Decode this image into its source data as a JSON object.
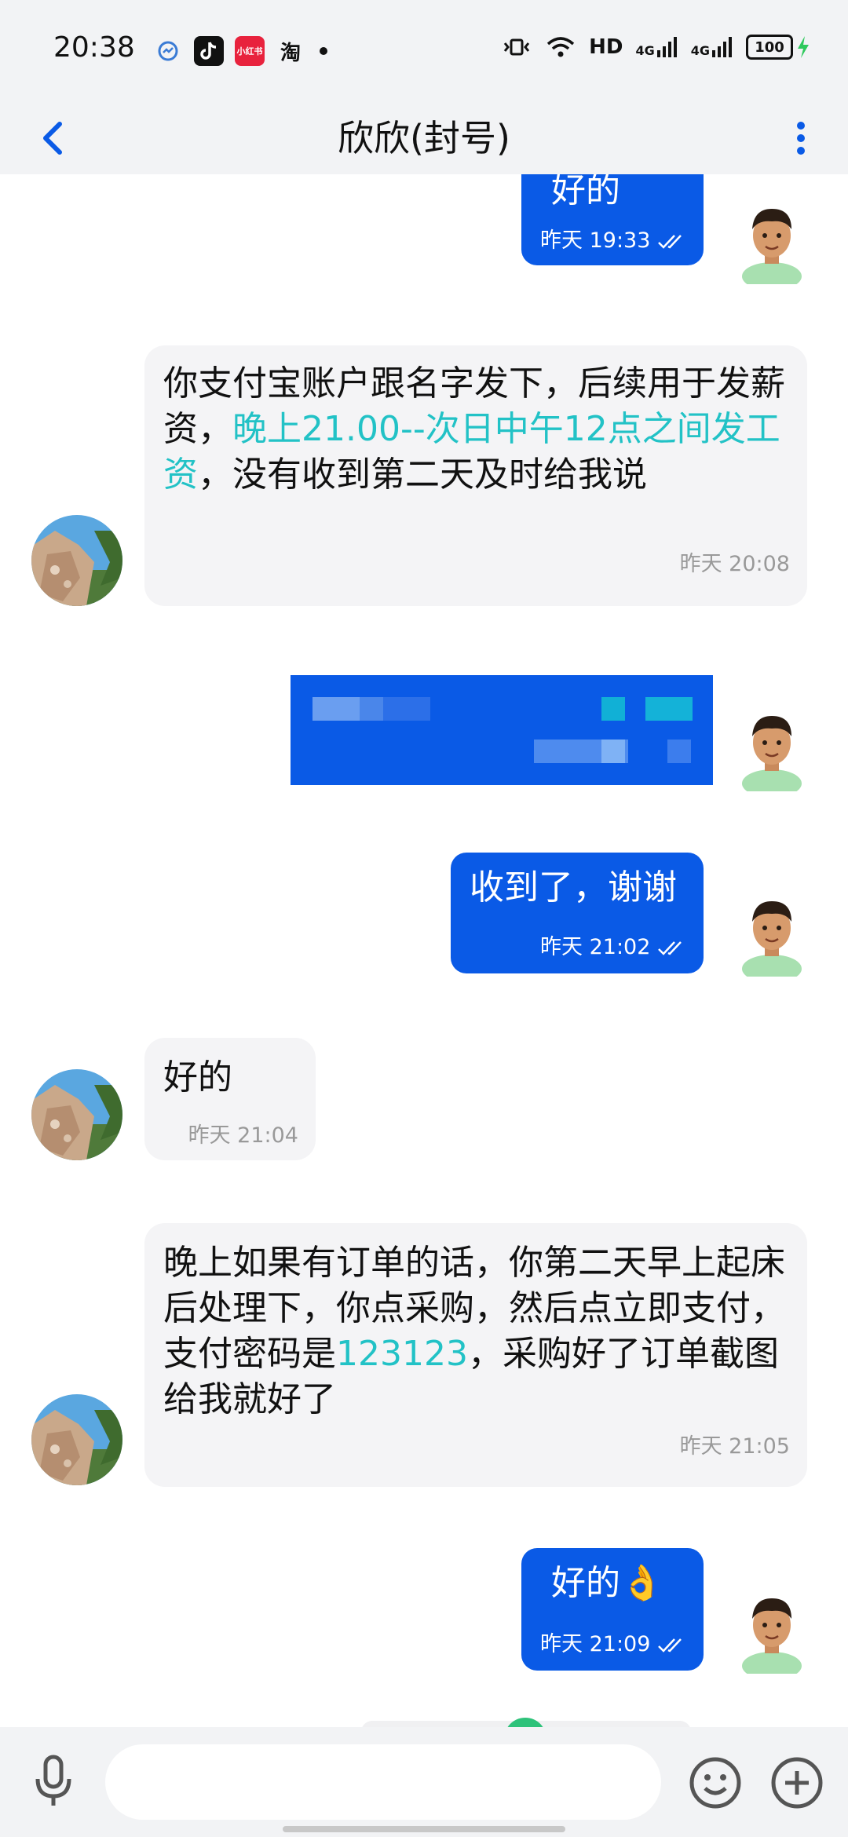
{
  "status_bar": {
    "time": "20:38",
    "app_icons": [
      "messenger-icon",
      "tiktok-icon",
      "xiaohongshu-icon",
      "taobao-icon"
    ],
    "taobao_char": "淘",
    "xhs_label": "小红书",
    "network": "HD",
    "signal1": "4G",
    "signal2": "4G",
    "battery": "100"
  },
  "header": {
    "title": "欣欣(封号)"
  },
  "messages": [
    {
      "from": "me",
      "text": "好的",
      "time": "昨天 19:33"
    },
    {
      "from": "them",
      "text_a": "你支付宝账户跟名字发下，后续用于发薪资，",
      "highlight": "晚上21.00--次日中午12点之间发工资",
      "text_b": "，没有收到第二天及时给我说",
      "time": "昨天 20:08"
    },
    {
      "from": "me",
      "type": "pixelated-image"
    },
    {
      "from": "me",
      "text": "收到了，谢谢",
      "time": "昨天 21:02"
    },
    {
      "from": "them",
      "text": "好的",
      "time": "昨天 21:04"
    },
    {
      "from": "them",
      "text_a": "晚上如果有订单的话，你第二天早上起床后处理下，你点采购，然后点立即支付，支付密码是",
      "highlight": "123123",
      "text_b": "，采购好了订单截图给我就好了",
      "time": "昨天 21:05"
    },
    {
      "from": "me",
      "text": "好的👌",
      "time": "昨天 21:09"
    }
  ],
  "colors": {
    "out_bubble": "#0a5ae6",
    "in_bubble": "#f4f4f6",
    "highlight": "#22c2c6",
    "accent": "#0a5ae6"
  }
}
